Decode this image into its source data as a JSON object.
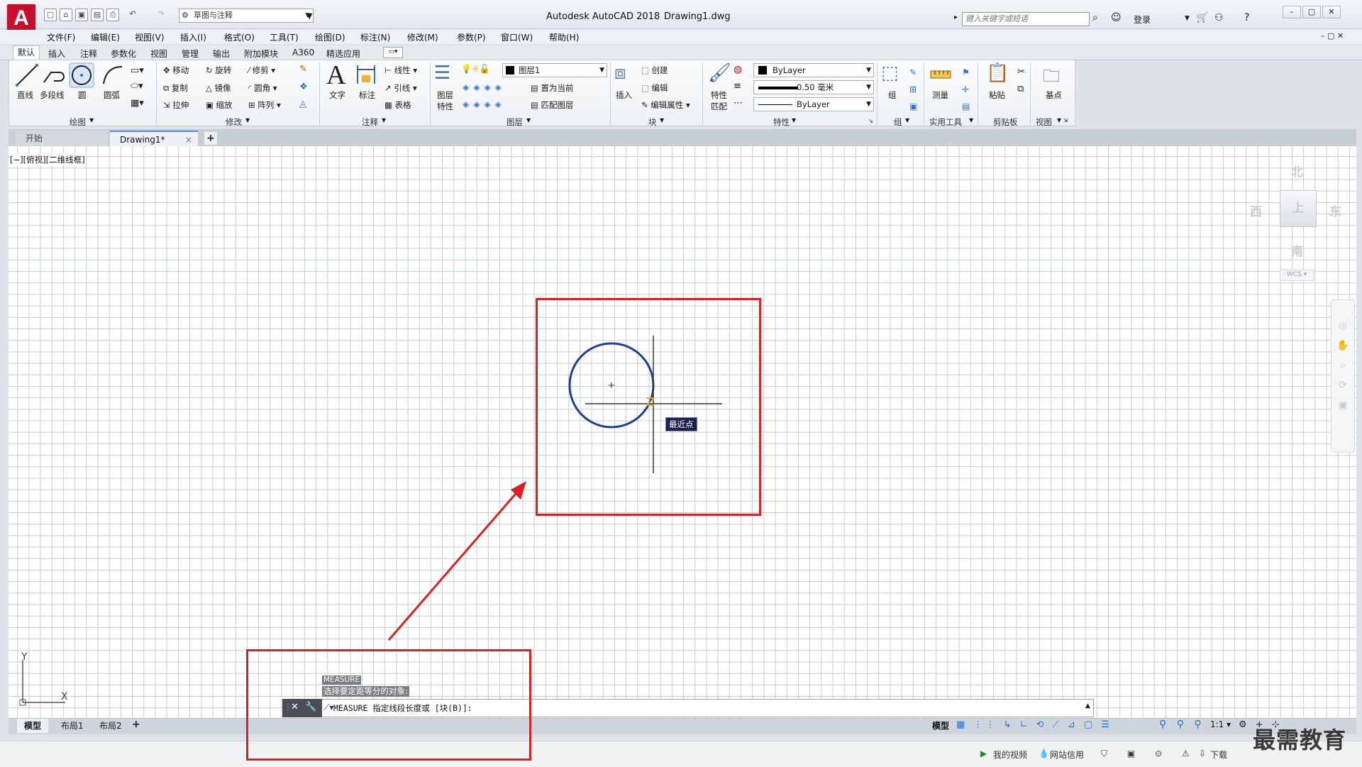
{
  "title_bar": {
    "app_title": "Autodesk AutoCAD 2018",
    "doc_title": "Drawing1.dwg",
    "workspace": "草图与注释",
    "search_placeholder": "键入关键字或短语",
    "login": "登录",
    "logo_letter": "A"
  },
  "menu": [
    "文件(F)",
    "编辑(E)",
    "视图(V)",
    "插入(I)",
    "格式(O)",
    "工具(T)",
    "绘图(D)",
    "标注(N)",
    "修改(M)",
    "参数(P)",
    "窗口(W)",
    "帮助(H)"
  ],
  "ribbon_tabs": [
    "默认",
    "插入",
    "注释",
    "参数化",
    "视图",
    "管理",
    "输出",
    "附加模块",
    "A360",
    "精选应用"
  ],
  "ribbon": {
    "draw": {
      "title": "绘图",
      "line": "直线",
      "polyline": "多段线",
      "circle": "圆",
      "arc": "圆弧"
    },
    "modify": {
      "title": "修改",
      "move": "移动",
      "rotate": "旋转",
      "trim": "修剪",
      "copy": "复制",
      "mirror": "镜像",
      "fillet": "圆角",
      "stretch": "拉伸",
      "scale": "缩放",
      "array": "阵列"
    },
    "annotation": {
      "title": "注释",
      "text": "文字",
      "dimension": "标注",
      "linear": "线性",
      "leader": "引线",
      "table": "表格"
    },
    "layers": {
      "title": "图层",
      "layer_props_1": "图层",
      "layer_props_2": "特性",
      "current_layer": "图层1",
      "make_current": "置为当前",
      "match_layer": "匹配图层"
    },
    "block": {
      "title": "块",
      "insert": "插入",
      "create": "创建",
      "edit": "编辑",
      "edit_attr": "编辑属性"
    },
    "properties": {
      "title": "特性",
      "match_1": "特性",
      "match_2": "匹配",
      "color": "ByLayer",
      "lineweight": "0.50 毫米",
      "linetype": "ByLayer"
    },
    "groups": {
      "title": "组",
      "group": "组"
    },
    "utilities": {
      "title": "实用工具",
      "measure": "测量"
    },
    "clipboard": {
      "title": "剪贴板",
      "paste": "粘贴"
    },
    "view": {
      "title": "视图",
      "base": "基点"
    }
  },
  "file_tabs": {
    "start": "开始",
    "drawing": "Drawing1*",
    "close": "×",
    "add": "+"
  },
  "viewport": {
    "label": "[−][俯视][二维线框]",
    "compass": {
      "north": "北",
      "south": "南",
      "east": "东",
      "west": "西",
      "top": "上"
    },
    "wcs": "WCS ▾",
    "ucs_x": "X",
    "ucs_y": "Y"
  },
  "osnap_tooltip": "最近点",
  "command": {
    "history_1": "MEASURE",
    "history_2": "选择要定距等分的对象:",
    "prompt": "MEASURE 指定线段长度或 [块(B)]:"
  },
  "layout_tabs": [
    "模型",
    "布局1",
    "布局2"
  ],
  "status": {
    "model": "模型",
    "scale": "1:1 ▾"
  },
  "os_bar": {
    "my_video": "我的视频",
    "network": "网站信用",
    "download": "下载"
  },
  "watermark": "最需教育",
  "colors": {
    "accent": "#c8102e",
    "highlight": "#e02020",
    "circle": "#1d3f94",
    "tooltip": "#1e1f4a"
  }
}
